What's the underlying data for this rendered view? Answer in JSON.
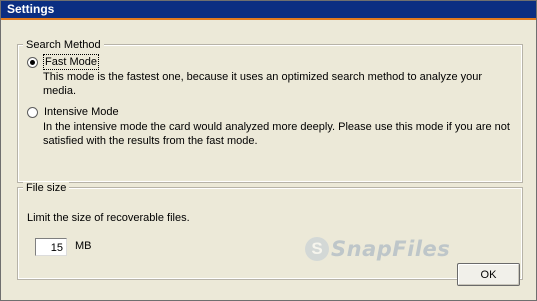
{
  "window": {
    "title": "Settings"
  },
  "search_method": {
    "legend": "Search Method",
    "options": [
      {
        "label": "Fast Mode",
        "selected": true,
        "description": [
          "This mode is the fastest one, because it uses an optimized search method to analyze your",
          "media."
        ]
      },
      {
        "label": "Intensive Mode",
        "selected": false,
        "description": [
          "In the intensive mode the card would analyzed more deeply. Please use this mode if you are not",
          "satisfied with the results from the fast mode."
        ]
      }
    ]
  },
  "file_size": {
    "legend": "File size",
    "description": "Limit the size of recoverable files.",
    "value": "15",
    "unit": "MB"
  },
  "buttons": {
    "ok": "OK"
  },
  "watermark": {
    "text": "SnapFiles",
    "logo_letter": "S"
  },
  "colors": {
    "title_bar": "#0b2e82",
    "title_accent": "#e07a1f",
    "background": "#ece9d8"
  }
}
